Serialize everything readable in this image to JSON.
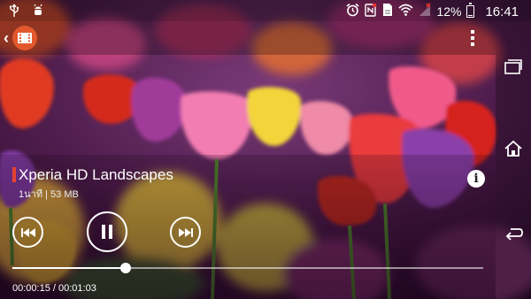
{
  "status_bar": {
    "battery_pct": "12%",
    "battery_level": 0.12,
    "clock": "16:41",
    "left_icons": [
      "usb-icon",
      "usb-debug-icon"
    ],
    "right_icons": [
      "alarm-icon",
      "nfc-icon",
      "sim-icon",
      "wifi-icon",
      "signal-icon",
      "battery-icon"
    ]
  },
  "app_bar": {
    "back_icon": "chevron-left-icon",
    "logo_icon": "movie-app-icon",
    "menu_icon": "overflow-menu-icon"
  },
  "video": {
    "title": "Xperia HD Landscapes",
    "meta": "1นาที | 53 MB",
    "elapsed": "00:00:15",
    "duration": "00:01:03",
    "time_readout": "00:00:15 / 00:01:03",
    "progress": 0.24
  },
  "controls": {
    "previous_icon": "skip-previous-icon",
    "pause_icon": "pause-icon",
    "next_icon": "skip-next-icon",
    "info_icon": "info-icon",
    "info_label": "i"
  },
  "nav_bar": {
    "icons": [
      "recent-apps-icon",
      "home-icon",
      "back-icon"
    ]
  },
  "colors": {
    "accent": "#e44332",
    "logo": "#e2582c"
  }
}
